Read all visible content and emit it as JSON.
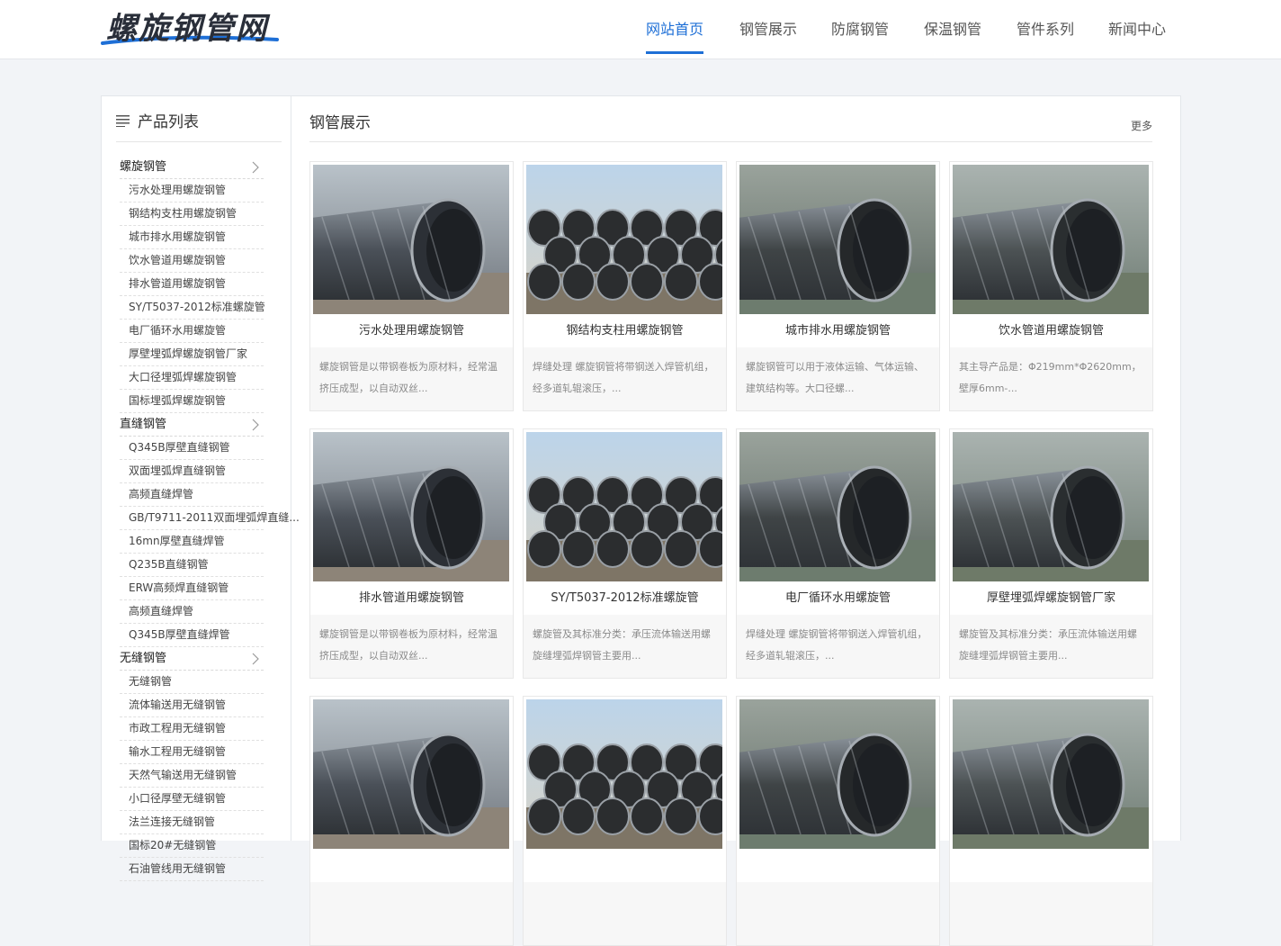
{
  "site": {
    "logo_text": "螺旋钢管网",
    "nav": [
      {
        "label": "网站首页",
        "active": true
      },
      {
        "label": "钢管展示",
        "active": false
      },
      {
        "label": "防腐钢管",
        "active": false
      },
      {
        "label": "保温钢管",
        "active": false
      },
      {
        "label": "管件系列",
        "active": false
      },
      {
        "label": "新闻中心",
        "active": false
      }
    ],
    "accent_color": "#1e6fd6"
  },
  "sidebar": {
    "title": "产品列表",
    "icon": "list-icon",
    "categories": [
      {
        "label": "螺旋钢管",
        "items": [
          "污水处理用螺旋钢管",
          "钢结构支柱用螺旋钢管",
          "城市排水用螺旋钢管",
          "饮水管道用螺旋钢管",
          "排水管道用螺旋钢管",
          "SY/T5037-2012标准螺旋管",
          "电厂循环水用螺旋管",
          "厚壁埋弧焊螺旋钢管厂家",
          "大口径埋弧焊螺旋钢管",
          "国标埋弧焊螺旋钢管"
        ]
      },
      {
        "label": "直缝钢管",
        "items": [
          "Q345B厚壁直缝钢管",
          "双面埋弧焊直缝钢管",
          "高频直缝焊管",
          "GB/T9711-2011双面埋弧焊直缝...",
          "16mn厚壁直缝焊管",
          "Q235B直缝钢管",
          "ERW高频焊直缝钢管",
          "高频直缝焊管",
          "Q345B厚壁直缝焊管"
        ]
      },
      {
        "label": "无缝钢管",
        "items": [
          "无缝钢管",
          "流体输送用无缝钢管",
          "市政工程用无缝钢管",
          "输水工程用无缝钢管",
          "天然气输送用无缝钢管",
          "小口径厚壁无缝钢管",
          "法兰连接无缝钢管",
          "国标20#无缝钢管",
          "石油管线用无缝钢管"
        ]
      }
    ]
  },
  "main": {
    "title": "钢管展示",
    "more": "更多",
    "products": [
      {
        "title": "污水处理用螺旋钢管",
        "desc": "螺旋钢管是以带钢卷板为原材料，经常温挤压成型，以自动双丝..."
      },
      {
        "title": "钢结构支柱用螺旋钢管",
        "desc": "焊缝处理 螺旋钢管将带钢送入焊管机组，经多道轧辊滚压，..."
      },
      {
        "title": "城市排水用螺旋钢管",
        "desc": "螺旋钢管可以用于液体运输、气体运输、建筑结构等。大口径螺..."
      },
      {
        "title": "饮水管道用螺旋钢管",
        "desc": "其主导产品是：Φ219mm*Φ2620mm，壁厚6mm-..."
      },
      {
        "title": "排水管道用螺旋钢管",
        "desc": "螺旋钢管是以带钢卷板为原材料，经常温挤压成型，以自动双丝..."
      },
      {
        "title": "SY/T5037-2012标准螺旋管",
        "desc": "螺旋管及其标准分类：承压流体输送用螺旋缝埋弧焊钢管主要用..."
      },
      {
        "title": "电厂循环水用螺旋管",
        "desc": "焊缝处理 螺旋钢管将带钢送入焊管机组，经多道轧辊滚压，..."
      },
      {
        "title": "厚壁埋弧焊螺旋钢管厂家",
        "desc": "螺旋管及其标准分类：承压流体输送用螺旋缝埋弧焊钢管主要用..."
      },
      {
        "title": "",
        "desc": ""
      },
      {
        "title": "",
        "desc": ""
      },
      {
        "title": "",
        "desc": ""
      },
      {
        "title": "",
        "desc": ""
      }
    ]
  }
}
